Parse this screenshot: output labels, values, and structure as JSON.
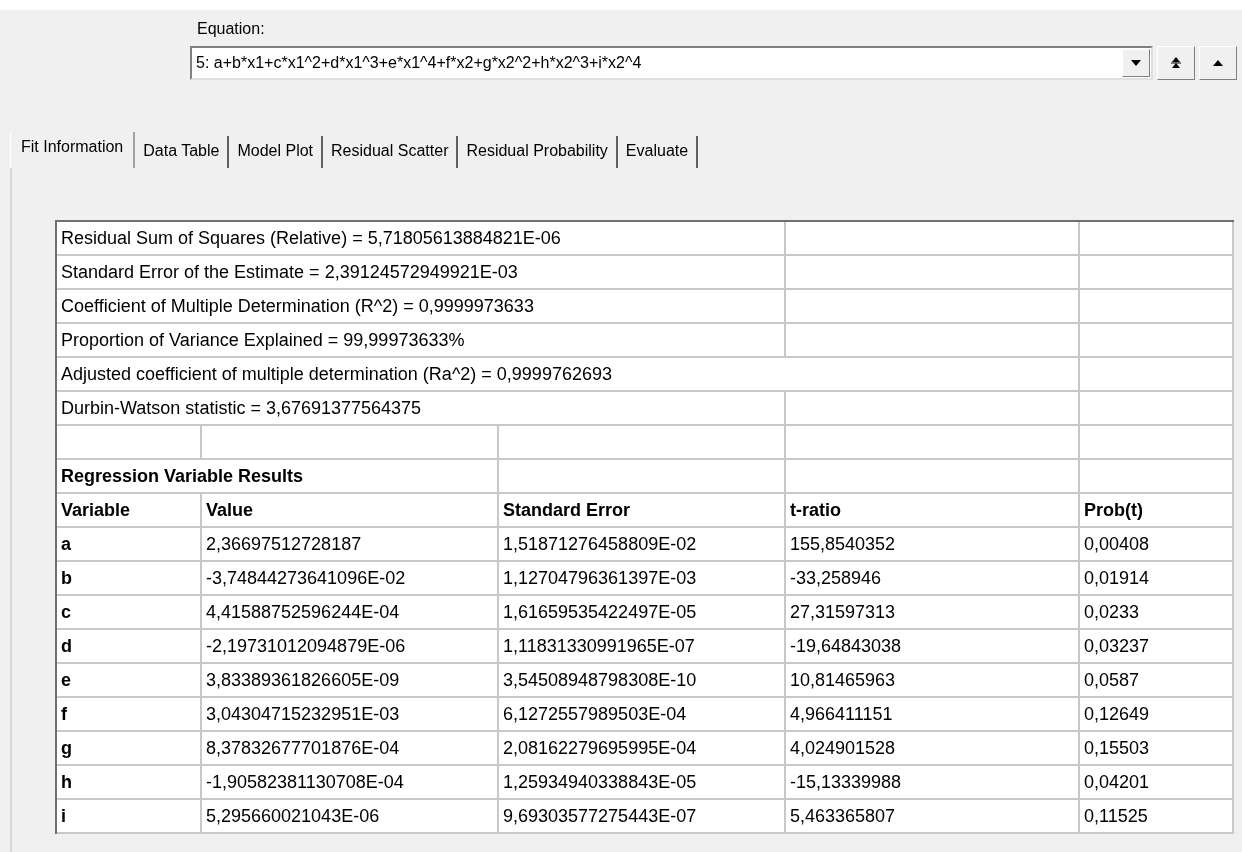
{
  "equation": {
    "label": "Equation:",
    "value": "5: a+b*x1+c*x1^2+d*x1^3+e*x1^4+f*x2+g*x2^2+h*x2^3+i*x2^4"
  },
  "tabs": [
    {
      "label": "Fit Information",
      "selected": true
    },
    {
      "label": "Data Table",
      "selected": false
    },
    {
      "label": "Model Plot",
      "selected": false
    },
    {
      "label": "Residual Scatter",
      "selected": false
    },
    {
      "label": "Residual Probability",
      "selected": false
    },
    {
      "label": "Evaluate",
      "selected": false
    }
  ],
  "summary": [
    "Residual Sum of Squares (Relative) = 5,71805613884821E-06",
    "Standard Error of the Estimate = 2,39124572949921E-03",
    "Coefficient of Multiple Determination (R^2) = 0,9999973633",
    "Proportion of Variance Explained = 99,99973633%",
    "Adjusted coefficient of multiple determination (Ra^2) = 0,9999762693",
    "Durbin-Watson statistic = 3,67691377564375"
  ],
  "results": {
    "title": "Regression Variable Results",
    "columns": [
      "Variable",
      "Value",
      "Standard Error",
      "t-ratio",
      "Prob(t)"
    ],
    "rows": [
      [
        "a",
        "2,36697512728187",
        "1,51871276458809E-02",
        "155,8540352",
        "0,00408"
      ],
      [
        "b",
        "-3,74844273641096E-02",
        "1,12704796361397E-03",
        "-33,258946",
        "0,01914"
      ],
      [
        "c",
        "4,41588752596244E-04",
        "1,61659535422497E-05",
        "27,31597313",
        "0,0233"
      ],
      [
        "d",
        "-2,19731012094879E-06",
        "1,11831330991965E-07",
        "-19,64843038",
        "0,03237"
      ],
      [
        "e",
        "3,83389361826605E-09",
        "3,54508948798308E-10",
        "10,81465963",
        "0,0587"
      ],
      [
        "f",
        "3,04304715232951E-03",
        "6,1272557989503E-04",
        "4,966411151",
        "0,12649"
      ],
      [
        "g",
        "8,37832677701876E-04",
        "2,08162279695995E-04",
        "4,024901528",
        "0,15503"
      ],
      [
        "h",
        "-1,90582381130708E-04",
        "1,25934940338843E-05",
        "-15,13339988",
        "0,04201"
      ],
      [
        "i",
        "5,295660021043E-06",
        "9,69303577275443E-07",
        "5,463365807",
        "0,11525"
      ]
    ]
  }
}
